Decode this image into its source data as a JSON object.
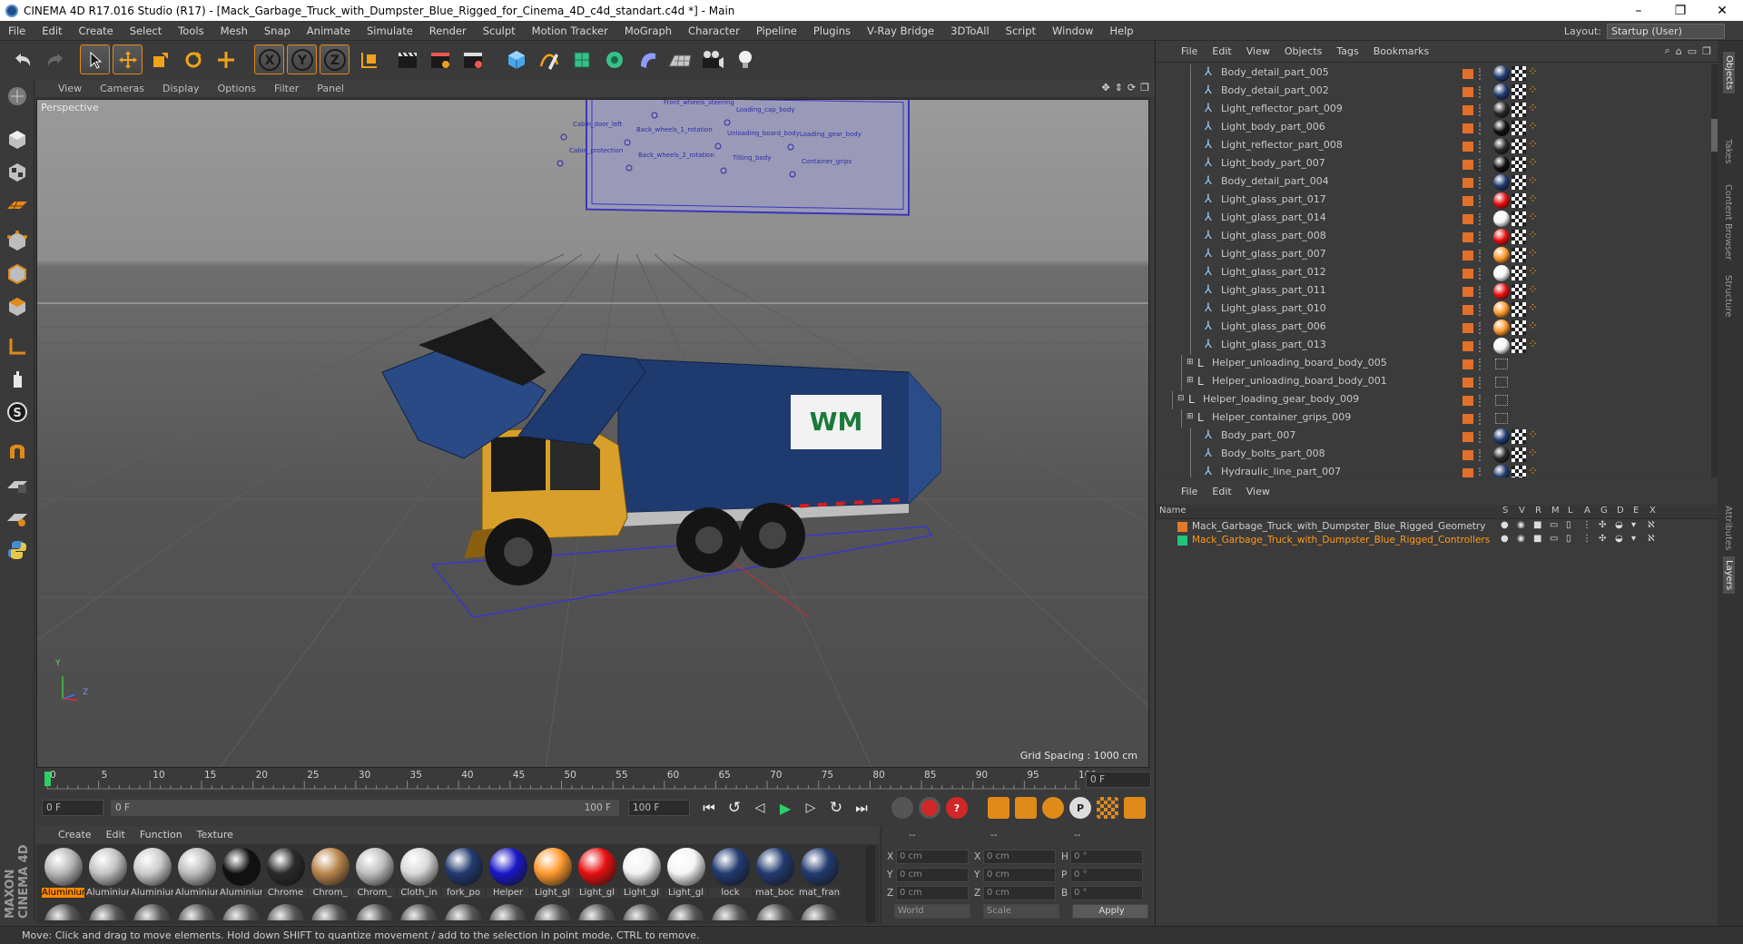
{
  "window": {
    "title": "CINEMA 4D R17.016 Studio (R17) - [Mack_Garbage_Truck_with_Dumpster_Blue_Rigged_for_Cinema_4D_c4d_standart.c4d *] - Main",
    "minimize": "–",
    "restore": "❐",
    "close": "✕"
  },
  "menubar": {
    "items": [
      "File",
      "Edit",
      "Create",
      "Select",
      "Tools",
      "Mesh",
      "Snap",
      "Animate",
      "Simulate",
      "Render",
      "Sculpt",
      "Motion Tracker",
      "MoGraph",
      "Character",
      "Pipeline",
      "Plugins",
      "V-Ray Bridge",
      "3DToAll",
      "Script",
      "Window",
      "Help"
    ],
    "layout_label": "Layout:",
    "layout_value": "Startup (User)"
  },
  "viewport": {
    "menu": [
      "View",
      "Cameras",
      "Display",
      "Options",
      "Filter",
      "Panel"
    ],
    "label": "Perspective",
    "grid_spacing": "Grid Spacing : 1000 cm",
    "axis_y": "Y",
    "axis_z": "Z",
    "logo_text": "WM",
    "control_labels": [
      "Front_wheels_steering",
      "Loading_cap_body",
      "Cabin_door_left",
      "Back_wheels_1_rotation",
      "Unloading_board_body",
      "Loading_gear_body",
      "Cabin_protection",
      "Back_wheels_2_rotation",
      "Tilting_body",
      "Container_grips"
    ]
  },
  "timeline": {
    "ticks": [
      "0",
      "5",
      "10",
      "15",
      "20",
      "25",
      "30",
      "35",
      "40",
      "45",
      "50",
      "55",
      "60",
      "65",
      "70",
      "75",
      "80",
      "85",
      "90",
      "95",
      "100"
    ],
    "current_frame": "0 F",
    "start_field": "0 F",
    "slider_start": "0 F",
    "slider_end": "100 F",
    "end_field": "100 F"
  },
  "material_manager": {
    "menu": [
      "Create",
      "Edit",
      "Function",
      "Texture"
    ],
    "materials": [
      {
        "name": "Aluminium",
        "color": "#b9b9b9",
        "active": true
      },
      {
        "name": "Aluminium",
        "color": "#c4c4c4"
      },
      {
        "name": "Aluminium",
        "color": "#cccccc"
      },
      {
        "name": "Aluminium",
        "color": "#bdbdbd"
      },
      {
        "name": "Aluminium",
        "color": "#111111"
      },
      {
        "name": "Chrome",
        "color": "#2a2a2a"
      },
      {
        "name": "Chrom_",
        "color": "#b9864e"
      },
      {
        "name": "Chrom_",
        "color": "#bfbfbf"
      },
      {
        "name": "Cloth_in",
        "color": "#d9d9d9"
      },
      {
        "name": "fork_po",
        "color": "#223b70"
      },
      {
        "name": "Helper",
        "color": "#1a18c8"
      },
      {
        "name": "Light_gl",
        "color": "#ff9a2e"
      },
      {
        "name": "Light_gl",
        "color": "#e81010"
      },
      {
        "name": "Light_gl",
        "color": "#f2f2f2"
      },
      {
        "name": "Light_gl",
        "color": "#f5f5f5"
      },
      {
        "name": "lock",
        "color": "#223b70"
      },
      {
        "name": "mat_boc",
        "color": "#223b70"
      },
      {
        "name": "mat_fran",
        "color": "#223b70"
      }
    ]
  },
  "coordinates": {
    "header": [
      "--",
      "--",
      "--"
    ],
    "rows": [
      {
        "a": "X",
        "av": "0 cm",
        "b": "X",
        "bv": "0 cm",
        "c": "H",
        "cv": "0 °"
      },
      {
        "a": "Y",
        "av": "0 cm",
        "b": "Y",
        "bv": "0 cm",
        "c": "P",
        "cv": "0 °"
      },
      {
        "a": "Z",
        "av": "0 cm",
        "b": "Z",
        "bv": "0 cm",
        "c": "B",
        "cv": "0 °"
      }
    ],
    "world": "World",
    "scale": "Scale",
    "apply": "Apply"
  },
  "object_manager": {
    "menu": [
      "File",
      "Edit",
      "View",
      "Objects",
      "Tags",
      "Bookmarks"
    ],
    "rows": [
      {
        "name": "Body_detail_part_005",
        "indent": 3,
        "type": "bone",
        "mat": "#223b70",
        "extra": true
      },
      {
        "name": "Body_detail_part_002",
        "indent": 3,
        "type": "bone",
        "mat": "#223b70",
        "extra": true
      },
      {
        "name": "Light_reflector_part_009",
        "indent": 3,
        "type": "bone",
        "mat": "#2a2a2a",
        "extra": true
      },
      {
        "name": "Light_body_part_006",
        "indent": 3,
        "type": "bone",
        "mat": "#111111",
        "extra": true
      },
      {
        "name": "Light_reflector_part_008",
        "indent": 3,
        "type": "bone",
        "mat": "#2a2a2a",
        "extra": true
      },
      {
        "name": "Light_body_part_007",
        "indent": 3,
        "type": "bone",
        "mat": "#111111",
        "extra": true
      },
      {
        "name": "Body_detail_part_004",
        "indent": 3,
        "type": "bone",
        "mat": "#223b70",
        "extra": true
      },
      {
        "name": "Light_glass_part_017",
        "indent": 3,
        "type": "bone",
        "mat": "#e81010",
        "extra": true
      },
      {
        "name": "Light_glass_part_014",
        "indent": 3,
        "type": "bone",
        "mat": "#f5f5f5",
        "extra": true
      },
      {
        "name": "Light_glass_part_008",
        "indent": 3,
        "type": "bone",
        "mat": "#e81010",
        "extra": true
      },
      {
        "name": "Light_glass_part_007",
        "indent": 3,
        "type": "bone",
        "mat": "#ff9a2e",
        "extra": true
      },
      {
        "name": "Light_glass_part_012",
        "indent": 3,
        "type": "bone",
        "mat": "#f5f5f5",
        "extra": true
      },
      {
        "name": "Light_glass_part_011",
        "indent": 3,
        "type": "bone",
        "mat": "#e81010",
        "extra": true
      },
      {
        "name": "Light_glass_part_010",
        "indent": 3,
        "type": "bone",
        "mat": "#ff9a2e",
        "extra": true
      },
      {
        "name": "Light_glass_part_006",
        "indent": 3,
        "type": "bone",
        "mat": "#ff9a2e",
        "extra": true
      },
      {
        "name": "Light_glass_part_013",
        "indent": 3,
        "type": "bone",
        "mat": "#f5f5f5",
        "extra": true
      },
      {
        "name": "Helper_unloading_board_body_005",
        "indent": 2,
        "type": "null",
        "collapsed": true
      },
      {
        "name": "Helper_unloading_board_body_001",
        "indent": 2,
        "type": "null",
        "collapsed": true
      },
      {
        "name": "Helper_loading_gear_body_009",
        "indent": 1,
        "type": "null",
        "expanded": true
      },
      {
        "name": "Helper_container_grips_009",
        "indent": 2,
        "type": "null",
        "collapsed": true
      },
      {
        "name": "Body_part_007",
        "indent": 3,
        "type": "bone",
        "mat": "#223b70",
        "extra": true
      },
      {
        "name": "Body_bolts_part_008",
        "indent": 3,
        "type": "bone",
        "mat": "#2a2a2a",
        "extra": true
      },
      {
        "name": "Hydraulic_line_part_007",
        "indent": 3,
        "type": "bone",
        "mat": "#223b70",
        "extra": true
      }
    ]
  },
  "layer_manager": {
    "menu": [
      "File",
      "Edit",
      "View"
    ],
    "col_name": "Name",
    "cols": [
      "S",
      "V",
      "R",
      "M",
      "L",
      "A",
      "G",
      "D",
      "E",
      "X"
    ],
    "layers": [
      {
        "name": "Mack_Garbage_Truck_with_Dumpster_Blue_Rigged_Geometry",
        "color": "#e07a2a",
        "textcolor": "#d0d0d0"
      },
      {
        "name": "Mack_Garbage_Truck_with_Dumpster_Blue_Rigged_Controllers",
        "color": "#22c47a",
        "textcolor": "#ff9a1a"
      }
    ]
  },
  "right_tabs": [
    "Objects",
    "Takes",
    "Content Browser",
    "Structure",
    "Attributes",
    "Layers"
  ],
  "maxon_logo": "MAXON CINEMA 4D",
  "status": "Move: Click and drag to move elements. Hold down SHIFT to quantize movement / add to the selection in point mode, CTRL to remove."
}
